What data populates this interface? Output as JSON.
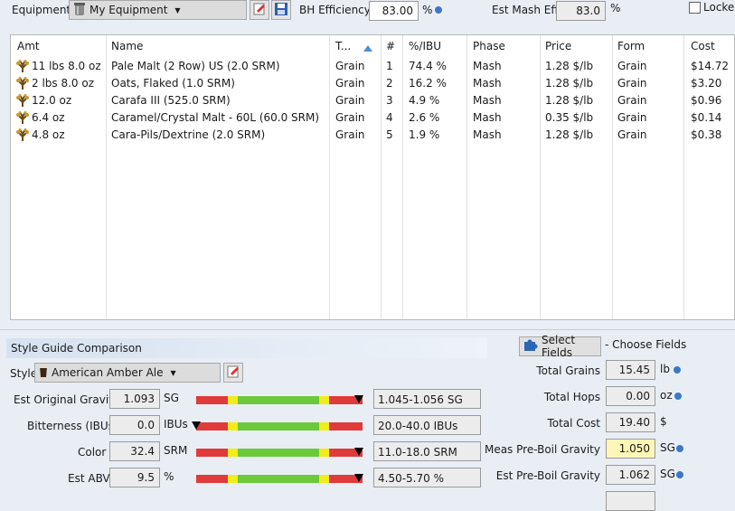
{
  "toolbar": {
    "equipment_label": "Equipment",
    "equipment_value": "My Equipment",
    "bh_eff_label": "BH Efficiency",
    "bh_eff_value": "83.00",
    "bh_eff_unit": "%",
    "est_mash_label": "Est Mash Eff",
    "est_mash_value": "83.0",
    "est_mash_unit": "%",
    "locked_label": "Locked"
  },
  "grid": {
    "headers": [
      "Amt",
      "Name",
      "T...",
      "#",
      "%/IBU",
      "Phase",
      "Price",
      "Form",
      "Cost"
    ],
    "rows": [
      {
        "amt": "11 lbs 8.0 oz",
        "name": "Pale Malt (2 Row) US (2.0 SRM)",
        "type": "Grain",
        "num": "1",
        "pct": "74.4 %",
        "phase": "Mash",
        "price": "1.28 $/lb",
        "form": "Grain",
        "cost": "$14.72"
      },
      {
        "amt": "2 lbs 8.0 oz",
        "name": "Oats, Flaked (1.0 SRM)",
        "type": "Grain",
        "num": "2",
        "pct": "16.2 %",
        "phase": "Mash",
        "price": "1.28 $/lb",
        "form": "Grain",
        "cost": "$3.20"
      },
      {
        "amt": "12.0 oz",
        "name": "Carafa III (525.0 SRM)",
        "type": "Grain",
        "num": "3",
        "pct": "4.9 %",
        "phase": "Mash",
        "price": "1.28 $/lb",
        "form": "Grain",
        "cost": "$0.96"
      },
      {
        "amt": "6.4 oz",
        "name": "Caramel/Crystal Malt - 60L (60.0 SRM)",
        "type": "Grain",
        "num": "4",
        "pct": "2.6 %",
        "phase": "Mash",
        "price": "0.35 $/lb",
        "form": "Grain",
        "cost": "$0.14"
      },
      {
        "amt": "4.8 oz",
        "name": "Cara-Pils/Dextrine (2.0 SRM)",
        "type": "Grain",
        "num": "5",
        "pct": "1.9 %",
        "phase": "Mash",
        "price": "1.28 $/lb",
        "form": "Grain",
        "cost": "$0.38"
      }
    ]
  },
  "style_guide": {
    "header": "Style Guide Comparison",
    "style_label": "Style",
    "style_value": "American Amber Ale",
    "metrics": [
      {
        "label": "Est Original Gravity",
        "value": "1.093",
        "unit": "SG",
        "range": "1.045-1.056 SG",
        "level": 0.98
      },
      {
        "label": "Bitterness (IBUs)",
        "value": "0.0",
        "unit": "IBUs",
        "range": "20.0-40.0 IBUs",
        "level": 0.0
      },
      {
        "label": "Color",
        "value": "32.4",
        "unit": "SRM",
        "range": "11.0-18.0 SRM",
        "level": 0.98
      },
      {
        "label": "Est ABV",
        "value": "9.5",
        "unit": "%",
        "range": "4.50-5.70 %",
        "level": 0.98
      }
    ]
  },
  "fields": {
    "select_button": "Select Fields",
    "choose_link": "- Choose Fields",
    "items": [
      {
        "label": "Total Grains",
        "value": "15.45",
        "unit": "lb"
      },
      {
        "label": "Total Hops",
        "value": "0.00",
        "unit": "oz"
      },
      {
        "label": "Total Cost",
        "value": "19.40",
        "unit": "$"
      },
      {
        "label": "Meas Pre-Boil Gravity",
        "value": "1.050",
        "unit": "SG"
      },
      {
        "label": "Est Pre-Boil Gravity",
        "value": "1.062",
        "unit": "SG"
      }
    ]
  },
  "colors": {
    "accent": "#3b79c8",
    "bar_red": "#e03a3a",
    "bar_yellow": "#f2ec1a",
    "bar_green": "#6cc93a",
    "highlight": "#fef6b6"
  }
}
